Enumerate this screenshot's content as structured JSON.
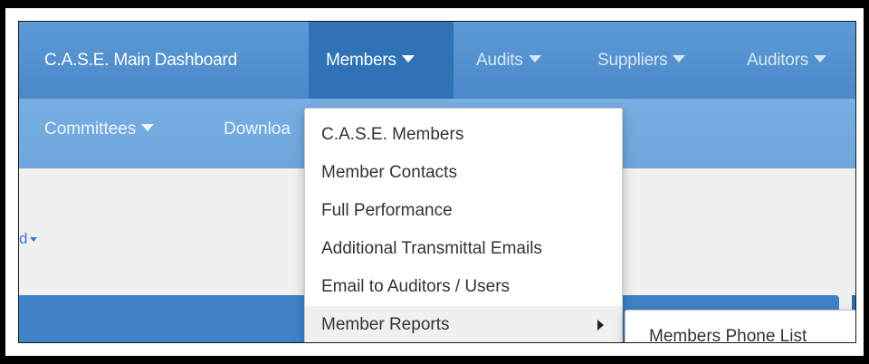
{
  "navbar": {
    "brand": "C.A.S.E. Main Dashboard",
    "items": [
      {
        "label": "Members"
      },
      {
        "label": "Audits"
      },
      {
        "label": "Suppliers"
      },
      {
        "label": "Auditors"
      }
    ],
    "row2": [
      {
        "label": "Committees"
      },
      {
        "label": "Downloa"
      }
    ]
  },
  "content": {
    "breadcrumb_fragment": "d"
  },
  "members_menu": {
    "items": [
      {
        "label": "C.A.S.E. Members"
      },
      {
        "label": "Member Contacts"
      },
      {
        "label": "Full Performance"
      },
      {
        "label": "Additional Transmittal Emails"
      },
      {
        "label": "Email to Auditors / Users"
      },
      {
        "label": "Member Reports"
      }
    ],
    "submenu": {
      "items": [
        {
          "label": "Members Phone List"
        }
      ]
    }
  },
  "colors": {
    "navbar": "#4a88c9",
    "navbar_active": "#2f73b6",
    "navbar_row2": "#6ea5db",
    "panel": "#3f82c8"
  }
}
